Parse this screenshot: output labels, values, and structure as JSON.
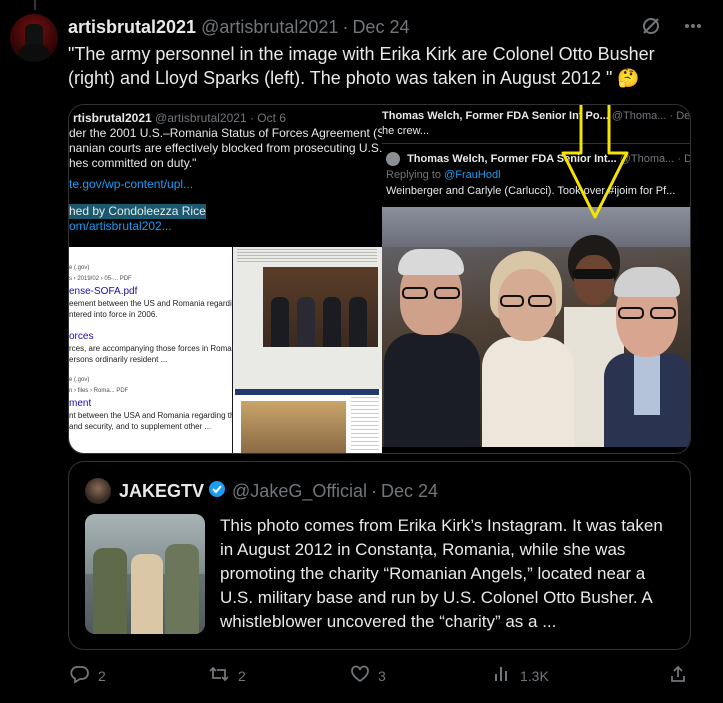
{
  "post": {
    "author_name": "artisbrutal2021",
    "author_handle": "@artisbrutal2021",
    "separator": "·",
    "date": "Dec 24",
    "text": "\"The army personnel in the image with Erika Kirk are Colonel Otto Busher (right) and Lloyd Sparks (left). The photo was taken in August 2012 \" 🤔"
  },
  "media_left": {
    "author_name": "rtisbrutal2021",
    "author_handle": "@artisbrutal2021 · Oct 6",
    "lines": [
      "der  the 2001 U.S.–Romania Status of Forces Agreement (SOFA),",
      "nanian  courts are effectively blocked from prosecuting U.S. troop",
      "hes  committed on duty.\""
    ],
    "link1": "te.gov/wp-content/upl...",
    "highlight": "hed by Condoleezza Rice",
    "link2": "om/artisbrutal202..."
  },
  "search_snippets": {
    "r1_meta": "e (.gov)",
    "r1_meta2": "s › 2019/02 › 05-... PDF",
    "r1_title": "ense-SOFA.pdf",
    "r1_text1": "eement between the US and Romania regarding US forces'",
    "r1_text2": "ntered into force in 2006.",
    "r2_title": "orces",
    "r2_text1": "rces, are accompanying those forces in Romania. It shall a",
    "r2_text2": "ersons ordinarily resident ...",
    "r3_meta": "e (.gov)",
    "r3_meta2": "n › files › Roma... PDF",
    "r3_title": "ment",
    "r3_text1": "nt between the USA and Romania regarding the status of",
    "r3_text2": "and security, and to supplement other  ..."
  },
  "media_right": {
    "top_name": "Thomas Welch, Former FDA Senior Int Po...",
    "top_handle": "@Thoma...",
    "top_date": "· Dec 23",
    "top_text": "he crew...",
    "reply_name": "Thomas Welch, Former FDA Senior Int...",
    "reply_handle": "@Thoma...",
    "reply_date": "· Dec 5, 20",
    "replying_prefix": "Replying to",
    "replying_handle": "@FrauHodl",
    "reply_text": "Weinberger and Carlyle (Carlucci).  Took over #ijoim for Pf..."
  },
  "quoted": {
    "author_name": "JAKEGTV",
    "author_handle": "@JakeG_Official",
    "separator": "·",
    "date": "Dec 24",
    "text": "This photo comes from Erika Kirk’s Instagram. It was taken in August 2012 in Constanța, Romania, while she was promoting the charity “Romanian Angels,” located near a U.S. military base and run by U.S. Colonel Otto Busher. A whistleblower uncovered the “charity” as a ..."
  },
  "actions": {
    "replies": "2",
    "reposts": "2",
    "likes": "3",
    "views": "1.3K"
  },
  "colors": {
    "background": "#000000",
    "text": "#e7e9ea",
    "muted": "#71767b",
    "link": "#1d9bf0",
    "border": "#2f3336",
    "arrow": "#f5e400",
    "verified": "#1d9bf0"
  },
  "icons": [
    "grok-icon",
    "more-icon",
    "verified-badge-icon",
    "reply-icon",
    "repost-icon",
    "like-icon",
    "views-icon",
    "share-icon"
  ]
}
